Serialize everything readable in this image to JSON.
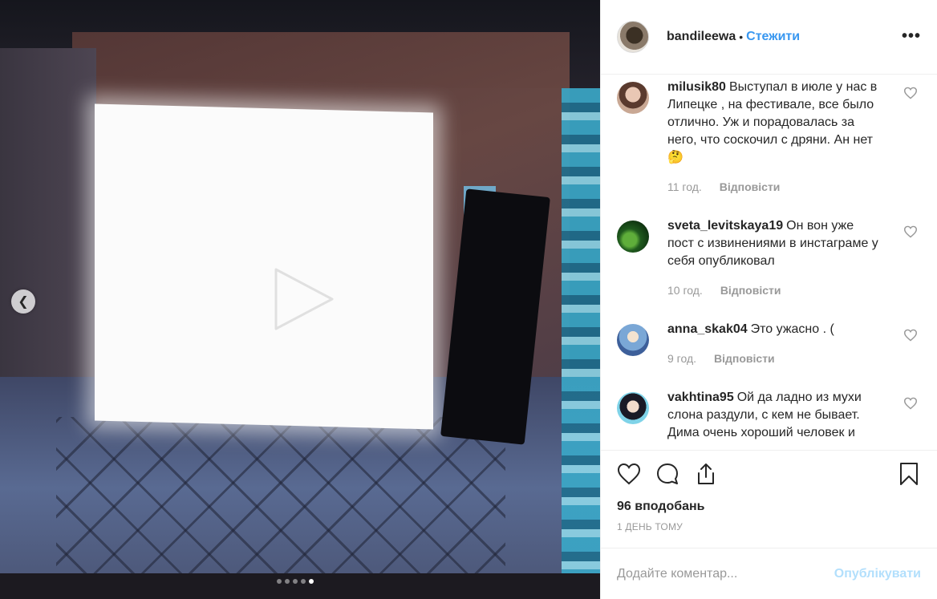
{
  "post": {
    "owner": "bandileewa",
    "separator": "•",
    "follow_label": "Стежити",
    "more_icon": "more-horizontal-icon",
    "slide_count": 5,
    "active_slide": 5,
    "likes_text": "96 вподобань",
    "timestamp": "1 ДЕНЬ ТОМУ"
  },
  "comments": [
    {
      "username": "milusik80",
      "text": "Выступал в июле у нас в Липецке , на фестивале, все было отлично. Уж и порадовалась за него, что соскочил с дряни. Ан нет🤔",
      "time": "11 год.",
      "reply": "Відповісти"
    },
    {
      "username": "sveta_levitskaya19",
      "text": "Он вон уже пост с извинениями в инстаграме у себя опубликовал",
      "time": "10 год.",
      "reply": "Відповісти"
    },
    {
      "username": "anna_skak04",
      "text": "Это ужасно . (",
      "time": "9 год.",
      "reply": "Відповісти"
    },
    {
      "username": "vakhtina95",
      "text": "Ой да ладно из мухи слона раздули, с кем не бывает. Дима очень хороший человек и",
      "time": "",
      "reply": ""
    }
  ],
  "add_comment": {
    "placeholder": "Додайте коментар...",
    "publish_label": "Опублікувати"
  },
  "colors": {
    "accent": "#3897f0",
    "publish_disabled": "#b2dffc",
    "muted": "#999999",
    "text": "#262626"
  }
}
